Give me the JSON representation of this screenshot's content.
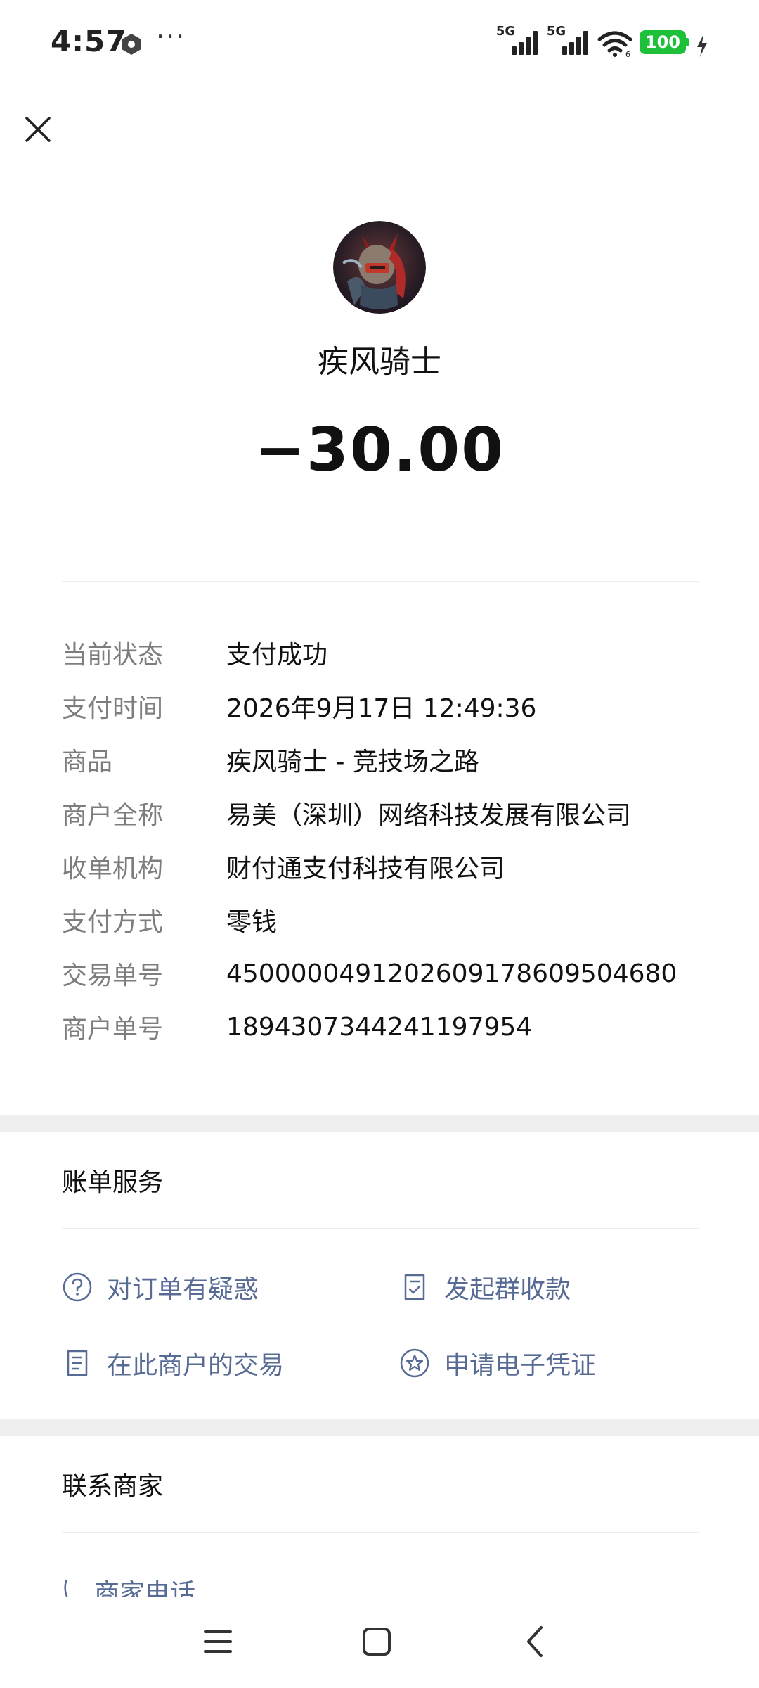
{
  "status_bar": {
    "time": "4:57",
    "more": "···",
    "sim1": "5G",
    "sim2": "5G",
    "wifi_badge": "6",
    "battery": "100"
  },
  "header": {
    "merchant_name": "疾风骑士",
    "amount": "−30.00"
  },
  "details": [
    {
      "label": "当前状态",
      "value": "支付成功"
    },
    {
      "label": "支付时间",
      "value": "2026年9月17日 12:49:36"
    },
    {
      "label": "商品",
      "value": "疾风骑士 - 竞技场之路"
    },
    {
      "label": "商户全称",
      "value": "易美（深圳）网络科技发展有限公司"
    },
    {
      "label": "收单机构",
      "value": "财付通支付科技有限公司"
    },
    {
      "label": "支付方式",
      "value": "零钱"
    },
    {
      "label": "交易单号",
      "value": "4500000491202609178609504680"
    },
    {
      "label": "商户单号",
      "value": "1894307344241197954"
    }
  ],
  "bill_services": {
    "title": "账单服务",
    "items": [
      {
        "label": "对订单有疑惑",
        "icon": "question-circle-icon"
      },
      {
        "label": "发起群收款",
        "icon": "document-check-icon"
      },
      {
        "label": "在此商户的交易",
        "icon": "document-list-icon"
      },
      {
        "label": "申请电子凭证",
        "icon": "star-circle-icon"
      }
    ]
  },
  "contact": {
    "title": "联系商家",
    "phone_label": "商家电话"
  },
  "colors": {
    "link": "#576b95",
    "battery": "#1ec03a",
    "separator": "#efefef"
  }
}
